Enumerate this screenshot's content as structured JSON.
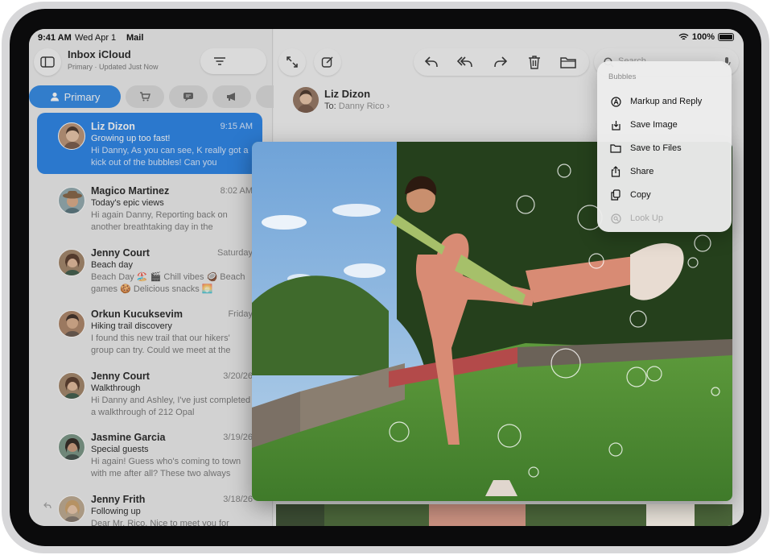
{
  "status_bar": {
    "time": "9:41 AM",
    "date": "Wed Apr 1",
    "app": "Mail",
    "battery": "100%"
  },
  "sidebar": {
    "mailbox_title": "Inbox iCloud",
    "mailbox_subtitle": "Primary · Updated Just Now",
    "categories": [
      {
        "label": "Primary",
        "icon": "person-icon",
        "active": true
      },
      {
        "label": "",
        "icon": "cart-icon"
      },
      {
        "label": "",
        "icon": "message-icon"
      },
      {
        "label": "",
        "icon": "megaphone-icon"
      }
    ]
  },
  "messages": [
    {
      "sender": "Liz Dizon",
      "date": "9:15 AM",
      "subject": "Growing up too fast!",
      "preview": "Hi Danny, As you can see, K really got a kick out of the bubbles! Can you",
      "selected": true
    },
    {
      "sender": "Magico Martinez",
      "date": "8:02 AM",
      "subject": "Today's epic views",
      "preview": "Hi again Danny, Reporting back on another breathtaking day in the"
    },
    {
      "sender": "Jenny Court",
      "date": "Saturday",
      "subject": "Beach day",
      "preview": "Beach Day 🏖️ 🎬 Chill vibes 🥥 Beach games 🍪 Delicious snacks 🌅"
    },
    {
      "sender": "Orkun Kucuksevim",
      "date": "Friday",
      "subject": "Hiking trail discovery",
      "preview": "I found this new trail that our hikers' group can try. Could we meet at the"
    },
    {
      "sender": "Jenny Court",
      "date": "3/20/26",
      "subject": "Walkthrough",
      "preview": "Hi Danny and Ashley, I've just completed a walkthrough of 212 Opal"
    },
    {
      "sender": "Jasmine Garcia",
      "date": "3/19/26",
      "subject": "Special guests",
      "preview": "Hi again! Guess who's coming to town with me after all? These two always"
    },
    {
      "sender": "Jenny Frith",
      "date": "3/18/26",
      "subject": "Following up",
      "preview": "Dear Mr. Rico, Nice to meet you for"
    }
  ],
  "detail": {
    "from_name": "Liz Dizon",
    "to_label": "To:",
    "to_name": "Danny Rico",
    "search_placeholder": "Search"
  },
  "context_menu": {
    "title": "Bubbles",
    "items": [
      {
        "label": "Markup and Reply",
        "icon": "markup-icon",
        "enabled": true
      },
      {
        "label": "Save Image",
        "icon": "save-image-icon",
        "enabled": true
      },
      {
        "label": "Save to Files",
        "icon": "folder-icon",
        "enabled": true
      },
      {
        "label": "Share",
        "icon": "share-icon",
        "enabled": true
      },
      {
        "label": "Copy",
        "icon": "copy-icon",
        "enabled": true
      },
      {
        "label": "Look Up",
        "icon": "look-up-icon",
        "enabled": false
      }
    ]
  },
  "colors": {
    "accent": "#1679e6"
  }
}
